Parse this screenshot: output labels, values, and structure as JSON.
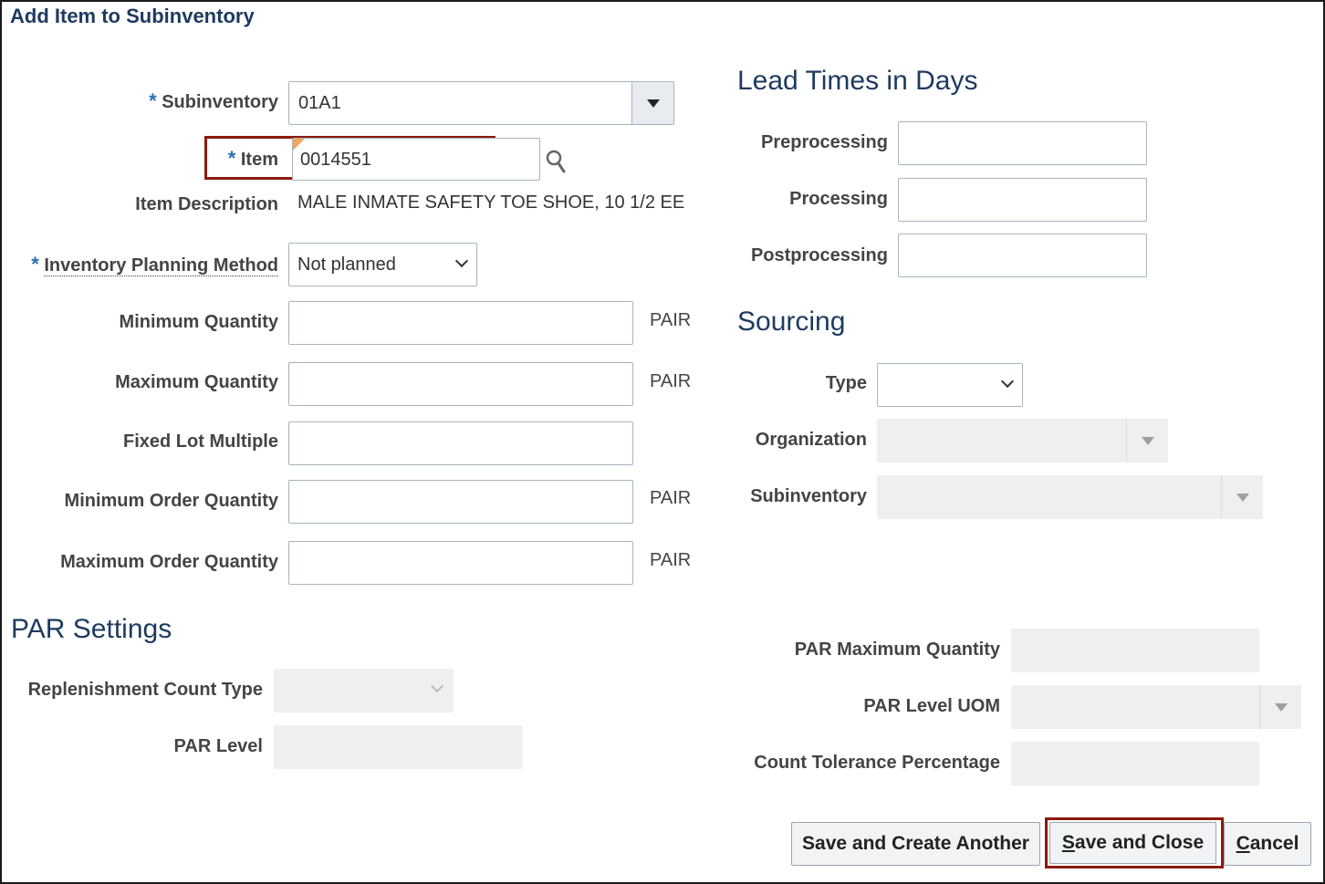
{
  "dialog": {
    "title": "Add Item to Subinventory"
  },
  "left": {
    "subinventory": {
      "label": "Subinventory",
      "value": "01A1"
    },
    "item": {
      "label": "Item",
      "value": "0014551"
    },
    "item_description": {
      "label": "Item Description",
      "value": "MALE INMATE SAFETY TOE SHOE, 10 1/2 EE"
    },
    "planning_method": {
      "label": "Inventory Planning Method",
      "value": "Not planned"
    },
    "min_qty": {
      "label": "Minimum Quantity",
      "uom": "PAIR"
    },
    "max_qty": {
      "label": "Maximum Quantity",
      "uom": "PAIR"
    },
    "fixed_lot": {
      "label": "Fixed Lot Multiple"
    },
    "min_order": {
      "label": "Minimum Order Quantity",
      "uom": "PAIR"
    },
    "max_order": {
      "label": "Maximum Order Quantity",
      "uom": "PAIR"
    },
    "required_marker": "*"
  },
  "lead_times": {
    "heading": "Lead Times in Days",
    "preprocessing": "Preprocessing",
    "processing": "Processing",
    "postprocessing": "Postprocessing"
  },
  "sourcing": {
    "heading": "Sourcing",
    "type": "Type",
    "organization": "Organization",
    "subinventory": "Subinventory"
  },
  "par": {
    "heading": "PAR Settings",
    "replenishment_count_type": "Replenishment Count Type",
    "par_level": "PAR Level",
    "par_max_qty": "PAR Maximum Quantity",
    "par_level_uom": "PAR Level UOM",
    "count_tolerance": "Count Tolerance Percentage"
  },
  "buttons": {
    "save_create_another": "Save and Create Another",
    "save_close_mnemonic": "S",
    "save_close_rest": "ave and Close",
    "cancel_mnemonic": "C",
    "cancel_rest": "ancel"
  },
  "colors": {
    "heading": "#1e3a5f",
    "required": "#2a6fb6",
    "highlight": "#8b1a0a"
  }
}
